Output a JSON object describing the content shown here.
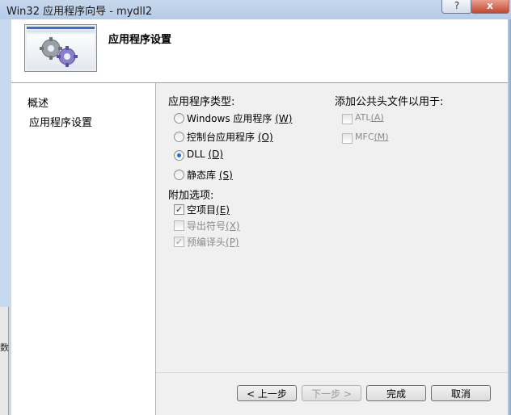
{
  "window": {
    "title": "Win32 应用程序向导 - mydll2",
    "help_glyph": "?",
    "close_glyph": "x",
    "left_strip_text": "数"
  },
  "header": {
    "title": "应用程序设置"
  },
  "nav": {
    "items": [
      "概述",
      "应用程序设置"
    ]
  },
  "app_type": {
    "label": "应用程序类型:",
    "options": [
      {
        "label": "Windows 应用程序",
        "key": "(W)",
        "checked": false
      },
      {
        "label": "控制台应用程序",
        "key": "(O)",
        "checked": false
      },
      {
        "label": "DLL",
        "key": "(D)",
        "checked": true
      },
      {
        "label": "静态库",
        "key": "(S)",
        "checked": false
      }
    ]
  },
  "extra_options": {
    "label": "附加选项:",
    "options": [
      {
        "label": "空项目",
        "key": "(E)",
        "checked": true,
        "enabled": true
      },
      {
        "label": "导出符号",
        "key": "(X)",
        "checked": false,
        "enabled": false
      },
      {
        "label": "预编译头",
        "key": "(P)",
        "checked": true,
        "enabled": false
      }
    ]
  },
  "common_headers": {
    "label": "添加公共头文件以用于:",
    "options": [
      {
        "label": "ATL",
        "key": "(A)",
        "checked": false,
        "enabled": false
      },
      {
        "label": "MFC",
        "key": "(M)",
        "checked": false,
        "enabled": false
      }
    ]
  },
  "buttons": {
    "prev": "< 上一步",
    "next": "下一步 >",
    "finish": "完成",
    "cancel": "取消"
  },
  "colors": {
    "radio_dot": "#1e73d6",
    "disabled_text": "#8a8a8a"
  }
}
